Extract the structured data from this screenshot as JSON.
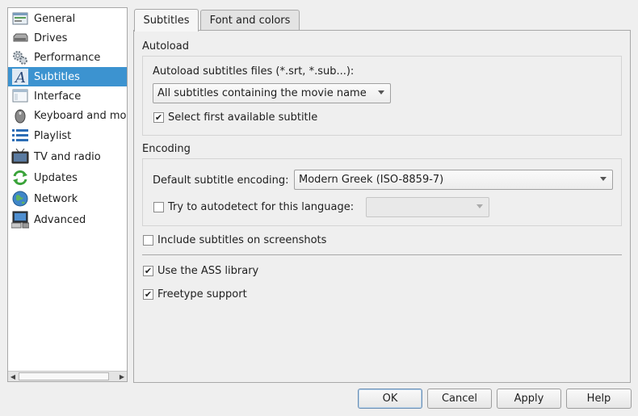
{
  "sidebar": {
    "items": [
      {
        "label": "General",
        "icon": "general-settings-icon"
      },
      {
        "label": "Drives",
        "icon": "drive-icon"
      },
      {
        "label": "Performance",
        "icon": "gears-icon"
      },
      {
        "label": "Subtitles",
        "icon": "subtitle-letter-icon",
        "selected": true
      },
      {
        "label": "Interface",
        "icon": "window-icon"
      },
      {
        "label": "Keyboard and mou",
        "icon": "mouse-icon"
      },
      {
        "label": "Playlist",
        "icon": "list-icon"
      },
      {
        "label": "TV and radio",
        "icon": "tv-icon"
      },
      {
        "label": "Updates",
        "icon": "refresh-icon"
      },
      {
        "label": "Network",
        "icon": "globe-icon"
      },
      {
        "label": "Advanced",
        "icon": "computer-icon"
      }
    ]
  },
  "tabs": {
    "subtitles": "Subtitles",
    "font_and_colors": "Font and colors"
  },
  "autoload": {
    "group_title": "Autoload",
    "files_label": "Autoload subtitles files (*.srt, *.sub...):",
    "files_value": "All subtitles containing the movie name",
    "select_first_label": "Select first available subtitle",
    "select_first_checked": true
  },
  "encoding": {
    "group_title": "Encoding",
    "default_label": "Default subtitle encoding:",
    "default_value": "Modern Greek (ISO-8859-7)",
    "autodetect_label": "Try to autodetect for this language:",
    "autodetect_checked": false,
    "autodetect_value": ""
  },
  "options": {
    "include_screenshots_label": "Include subtitles on screenshots",
    "include_screenshots_checked": false,
    "ass_label": "Use the ASS library",
    "ass_checked": true,
    "freetype_label": "Freetype support",
    "freetype_checked": true
  },
  "buttons": {
    "ok": "OK",
    "cancel": "Cancel",
    "apply": "Apply",
    "help": "Help"
  },
  "colors": {
    "selection": "#3c93d0",
    "window_bg": "#efefef"
  }
}
